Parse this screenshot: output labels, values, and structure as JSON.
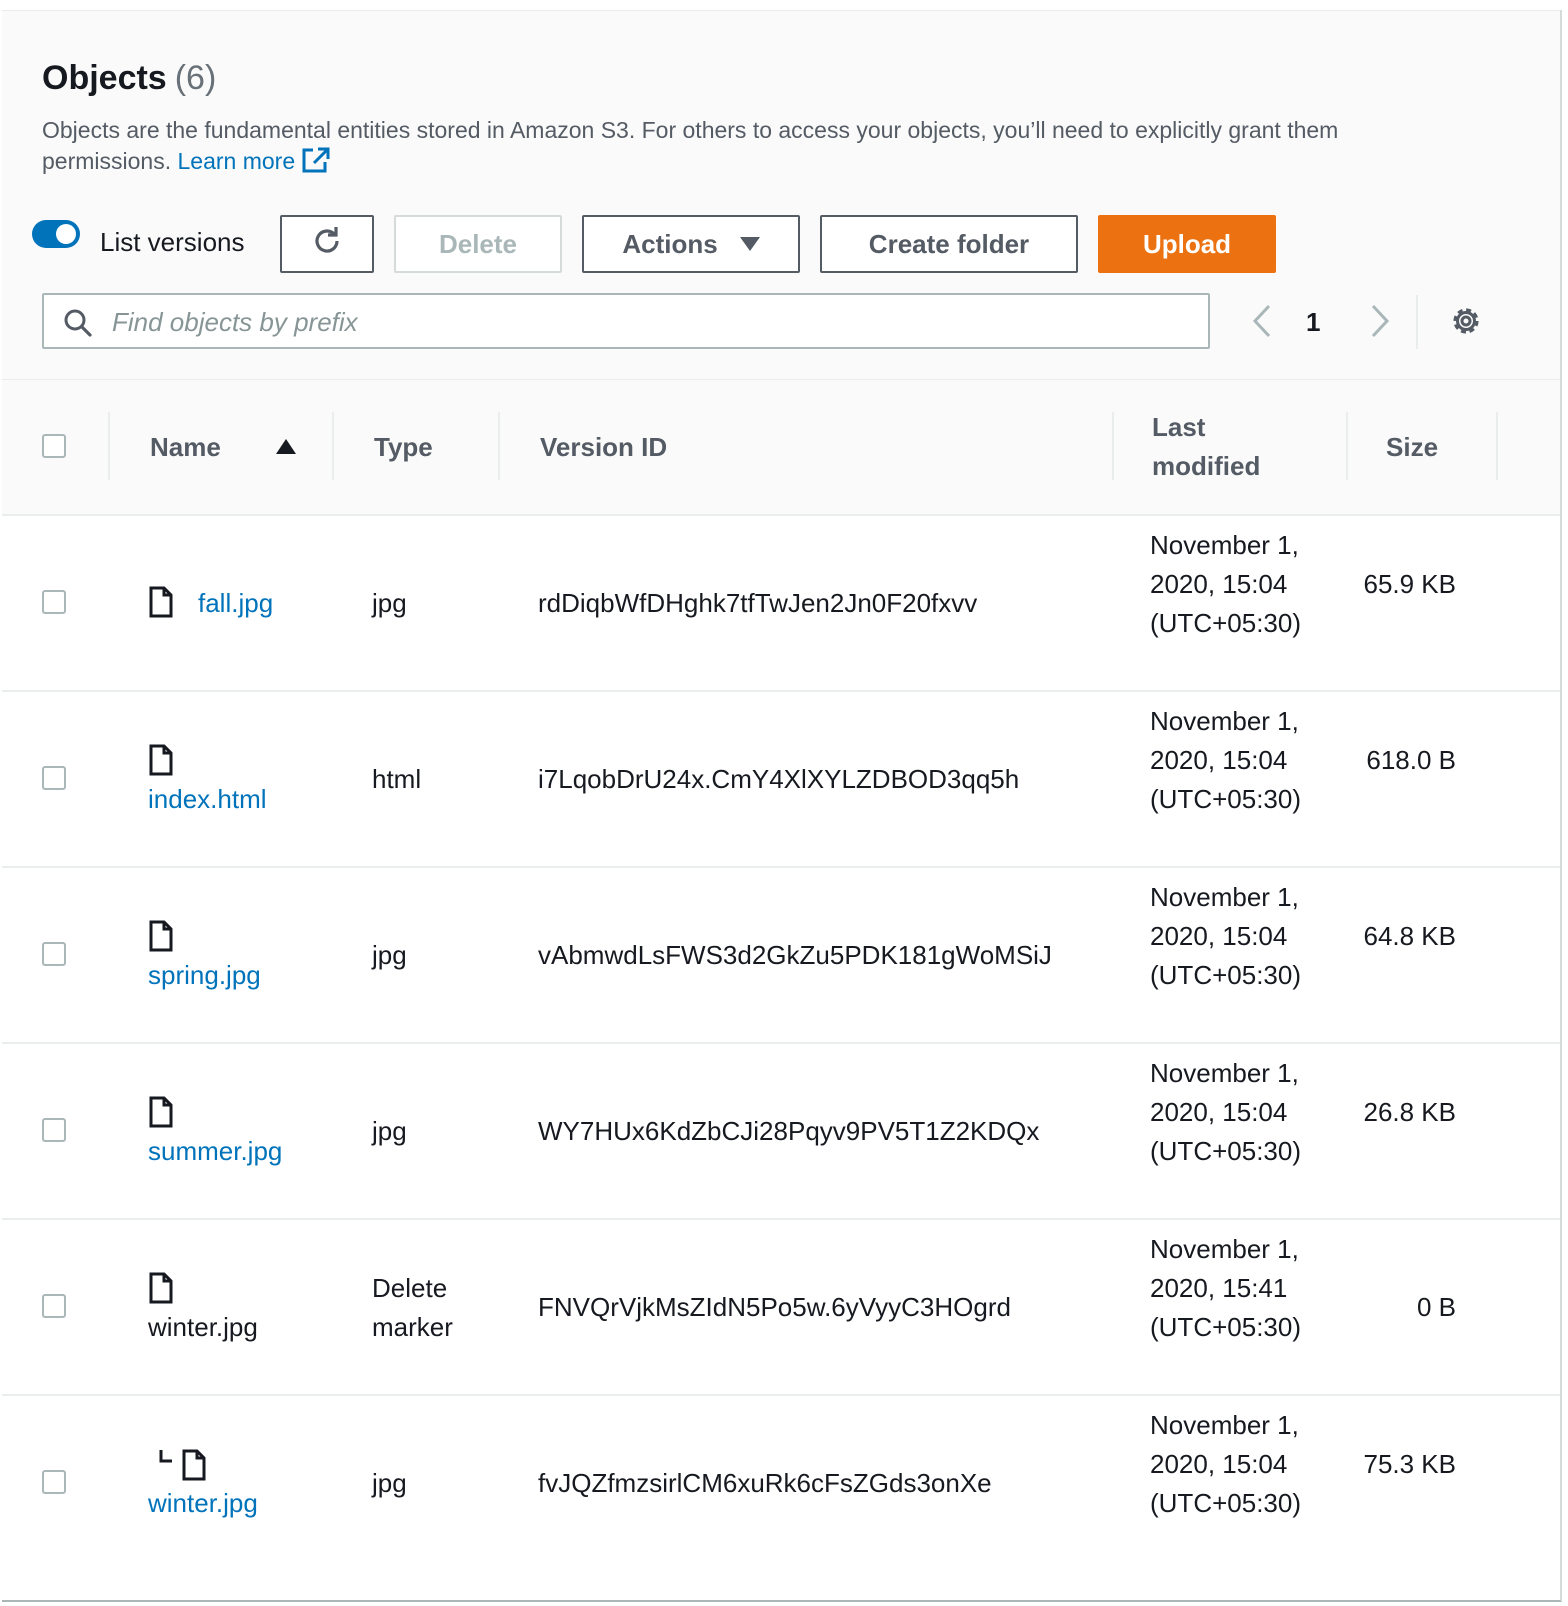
{
  "header": {
    "title": "Objects",
    "count": "(6)",
    "description": "Objects are the fundamental entities stored in Amazon S3. For others to access your objects, you’ll need to explicitly grant them permissions.",
    "learn_more": "Learn more"
  },
  "toolbar": {
    "list_versions_label": "List versions",
    "list_versions_enabled": true,
    "delete_label": "Delete",
    "actions_label": "Actions",
    "create_folder_label": "Create folder",
    "upload_label": "Upload"
  },
  "search": {
    "placeholder": "Find objects by prefix",
    "value": ""
  },
  "pagination": {
    "current_page": "1"
  },
  "table": {
    "columns": [
      "Name",
      "Type",
      "Version ID",
      "Last modified",
      "Size"
    ],
    "sort": {
      "column": "Name",
      "direction": "ascending"
    },
    "rows": [
      {
        "name": "fall.jpg",
        "type": "jpg",
        "version_id": "rdDiqbWfDHghk7tfTwJen2Jn0F20fxvv",
        "last_modified": "November 1, 2020, 15:04 (UTC+05:30)",
        "size": "65.9 KB",
        "icon": "file-icon",
        "is_link": true
      },
      {
        "name": "index.html",
        "type": "html",
        "version_id": "i7LqobDrU24x.CmY4XlXYLZDBOD3qq5h",
        "last_modified": "November 1, 2020, 15:04 (UTC+05:30)",
        "size": "618.0 B",
        "icon": "file-icon",
        "is_link": true
      },
      {
        "name": "spring.jpg",
        "type": "jpg",
        "version_id": "vAbmwdLsFWS3d2GkZu5PDK181gWoMSiJ",
        "last_modified": "November 1, 2020, 15:04 (UTC+05:30)",
        "size": "64.8 KB",
        "icon": "file-icon",
        "is_link": true
      },
      {
        "name": "summer.jpg",
        "type": "jpg",
        "version_id": "WY7HUx6KdZbCJi28Pqyv9PV5T1Z2KDQx",
        "last_modified": "November 1, 2020, 15:04 (UTC+05:30)",
        "size": "26.8 KB",
        "icon": "file-icon",
        "is_link": true
      },
      {
        "name": "winter.jpg",
        "type": "Delete marker",
        "version_id": "FNVQrVjkMsZIdN5Po5w.6yVyyC3HOgrd",
        "last_modified": "November 1, 2020, 15:41 (UTC+05:30)",
        "size": "0 B",
        "icon": "file-icon",
        "is_link": false
      },
      {
        "name": "winter.jpg",
        "type": "jpg",
        "version_id": "fvJQZfmzsirlCM6xuRk6cFsZGds3onXe",
        "last_modified": "November 1, 2020, 15:04 (UTC+05:30)",
        "size": "75.3 KB",
        "icon": "version-file-icon",
        "is_link": true
      }
    ]
  },
  "colors": {
    "accent": "#0073bb",
    "primary_button": "#ec7211",
    "text": "#16191f",
    "muted_text": "#545b64"
  }
}
